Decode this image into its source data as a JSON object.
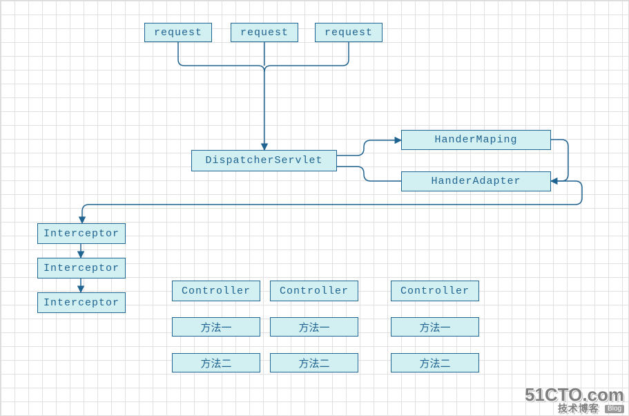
{
  "colors": {
    "node_fill": "#d2f0f2",
    "node_border": "#1f6391",
    "edge": "#1f6391",
    "grid": "#e0e0e0"
  },
  "nodes": {
    "req1": "request",
    "req2": "request",
    "req3": "request",
    "dispatcher": "DispatcherServlet",
    "handerMaping": "HanderMaping",
    "handerAdapter": "HanderAdapter",
    "interceptor1": "Interceptor",
    "interceptor2": "Interceptor",
    "interceptor3": "Interceptor",
    "controller1": "Controller",
    "controller2": "Controller",
    "controller3": "Controller",
    "method1a": "方法一",
    "method1b": "方法一",
    "method1c": "方法一",
    "method2a": "方法二",
    "method2b": "方法二",
    "method2c": "方法二"
  },
  "watermark": {
    "line1": "51CTO.com",
    "line2": "技术博客",
    "badge": "Blog"
  }
}
